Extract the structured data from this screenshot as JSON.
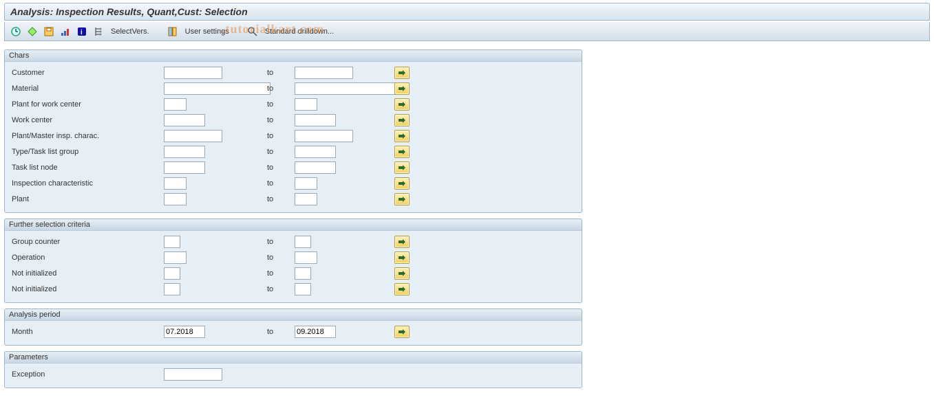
{
  "title": "Analysis: Inspection Results, Quant,Cust: Selection",
  "toolbar": {
    "select_vers": "SelectVers.",
    "user_settings": "User settings",
    "standard_drilldown": "Standard drilldown..."
  },
  "watermark": ".tutorialkart.com",
  "groups": {
    "chars": {
      "title": "Chars",
      "rows": [
        {
          "label": "Customer",
          "from": "",
          "to": "",
          "to_label": "to",
          "from_w": "w-l",
          "to_w": "w-l"
        },
        {
          "label": "Material",
          "from": "",
          "to": "",
          "to_label": "to",
          "from_w": "w-mat",
          "to_w": "w-mat"
        },
        {
          "label": "Plant for work center",
          "from": "",
          "to": "",
          "to_label": "to",
          "from_w": "w-s",
          "to_w": "w-s"
        },
        {
          "label": "Work center",
          "from": "",
          "to": "",
          "to_label": "to",
          "from_w": "w-m",
          "to_w": "w-m"
        },
        {
          "label": "Plant/Master insp. charac.",
          "from": "",
          "to": "",
          "to_label": "to",
          "from_w": "w-l",
          "to_w": "w-l"
        },
        {
          "label": "Type/Task list group",
          "from": "",
          "to": "",
          "to_label": "to",
          "from_w": "w-m",
          "to_w": "w-m"
        },
        {
          "label": "Task list node",
          "from": "",
          "to": "",
          "to_label": "to",
          "from_w": "w-m",
          "to_w": "w-m"
        },
        {
          "label": "Inspection characteristic",
          "from": "",
          "to": "",
          "to_label": "to",
          "from_w": "w-s",
          "to_w": "w-s"
        },
        {
          "label": "Plant",
          "from": "",
          "to": "",
          "to_label": "to",
          "from_w": "w-s",
          "to_w": "w-s"
        }
      ]
    },
    "further": {
      "title": "Further selection criteria",
      "rows": [
        {
          "label": "Group counter",
          "from": "",
          "to": "",
          "to_label": "to",
          "from_w": "w-xs",
          "to_w": "w-xs"
        },
        {
          "label": "Operation",
          "from": "",
          "to": "",
          "to_label": "to",
          "from_w": "w-s",
          "to_w": "w-s"
        },
        {
          "label": "Not initialized",
          "from": "",
          "to": "",
          "to_label": "to",
          "from_w": "w-xs",
          "to_w": "w-xs"
        },
        {
          "label": "Not initialized",
          "from": "",
          "to": "",
          "to_label": "to",
          "from_w": "w-xs",
          "to_w": "w-xs"
        }
      ]
    },
    "period": {
      "title": "Analysis period",
      "rows": [
        {
          "label": "Month",
          "from": "07.2018",
          "to": "09.2018",
          "to_label": "to",
          "from_w": "w-date",
          "to_w": "w-date"
        }
      ]
    },
    "params": {
      "title": "Parameters",
      "rows": [
        {
          "label": "Exception",
          "from": "",
          "to": null,
          "to_label": "",
          "from_w": "w-l",
          "to_w": ""
        }
      ]
    }
  }
}
